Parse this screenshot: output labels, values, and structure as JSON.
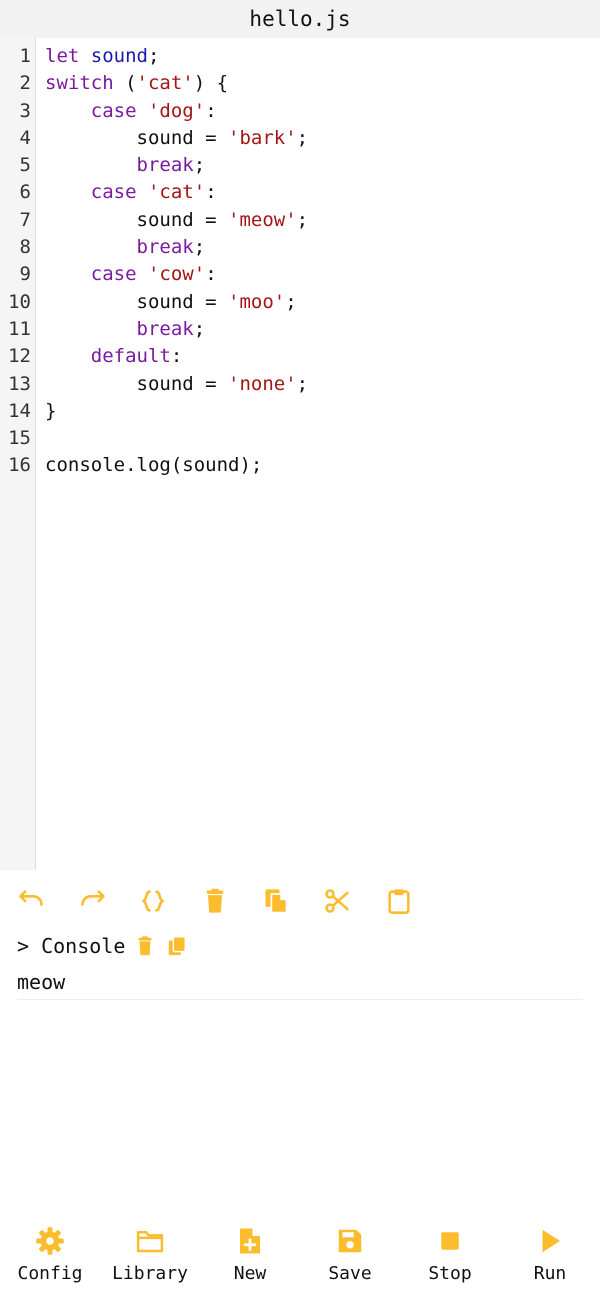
{
  "title": "hello.js",
  "accent_color": "#FBBC2E",
  "editor": {
    "line_numbers": [
      "1",
      "2",
      "3",
      "4",
      "5",
      "6",
      "7",
      "8",
      "9",
      "10",
      "11",
      "12",
      "13",
      "14",
      "15",
      "16"
    ],
    "lines": [
      [
        {
          "t": "let",
          "c": "kw"
        },
        {
          "t": " ",
          "c": "plain"
        },
        {
          "t": "sound",
          "c": "def"
        },
        {
          "t": ";",
          "c": "plain"
        }
      ],
      [
        {
          "t": "switch",
          "c": "kw"
        },
        {
          "t": " (",
          "c": "plain"
        },
        {
          "t": "'cat'",
          "c": "str"
        },
        {
          "t": ") {",
          "c": "plain"
        }
      ],
      [
        {
          "t": "    ",
          "c": "plain"
        },
        {
          "t": "case",
          "c": "kw"
        },
        {
          "t": " ",
          "c": "plain"
        },
        {
          "t": "'dog'",
          "c": "str"
        },
        {
          "t": ":",
          "c": "plain"
        }
      ],
      [
        {
          "t": "        sound = ",
          "c": "plain"
        },
        {
          "t": "'bark'",
          "c": "str"
        },
        {
          "t": ";",
          "c": "plain"
        }
      ],
      [
        {
          "t": "        ",
          "c": "plain"
        },
        {
          "t": "break",
          "c": "kw"
        },
        {
          "t": ";",
          "c": "plain"
        }
      ],
      [
        {
          "t": "    ",
          "c": "plain"
        },
        {
          "t": "case",
          "c": "kw"
        },
        {
          "t": " ",
          "c": "plain"
        },
        {
          "t": "'cat'",
          "c": "str"
        },
        {
          "t": ":",
          "c": "plain"
        }
      ],
      [
        {
          "t": "        sound = ",
          "c": "plain"
        },
        {
          "t": "'meow'",
          "c": "str"
        },
        {
          "t": ";",
          "c": "plain"
        }
      ],
      [
        {
          "t": "        ",
          "c": "plain"
        },
        {
          "t": "break",
          "c": "kw"
        },
        {
          "t": ";",
          "c": "plain"
        }
      ],
      [
        {
          "t": "    ",
          "c": "plain"
        },
        {
          "t": "case",
          "c": "kw"
        },
        {
          "t": " ",
          "c": "plain"
        },
        {
          "t": "'cow'",
          "c": "str"
        },
        {
          "t": ":",
          "c": "plain"
        }
      ],
      [
        {
          "t": "        sound = ",
          "c": "plain"
        },
        {
          "t": "'moo'",
          "c": "str"
        },
        {
          "t": ";",
          "c": "plain"
        }
      ],
      [
        {
          "t": "        ",
          "c": "plain"
        },
        {
          "t": "break",
          "c": "kw"
        },
        {
          "t": ";",
          "c": "plain"
        }
      ],
      [
        {
          "t": "    ",
          "c": "plain"
        },
        {
          "t": "default",
          "c": "kw"
        },
        {
          "t": ":",
          "c": "plain"
        }
      ],
      [
        {
          "t": "        sound = ",
          "c": "plain"
        },
        {
          "t": "'none'",
          "c": "str"
        },
        {
          "t": ";",
          "c": "plain"
        }
      ],
      [
        {
          "t": "}",
          "c": "plain"
        }
      ],
      [
        {
          "t": "",
          "c": "plain"
        }
      ],
      [
        {
          "t": "console.log(sound);",
          "c": "plain"
        }
      ]
    ]
  },
  "toolbar": {
    "icons": [
      "undo-icon",
      "redo-icon",
      "format-braces-icon",
      "delete-icon",
      "copy-file-icon",
      "cut-icon",
      "paste-icon"
    ]
  },
  "console": {
    "label": "> Console",
    "output": "meow"
  },
  "nav": {
    "config": "Config",
    "library": "Library",
    "new": "New",
    "save": "Save",
    "stop": "Stop",
    "run": "Run"
  }
}
